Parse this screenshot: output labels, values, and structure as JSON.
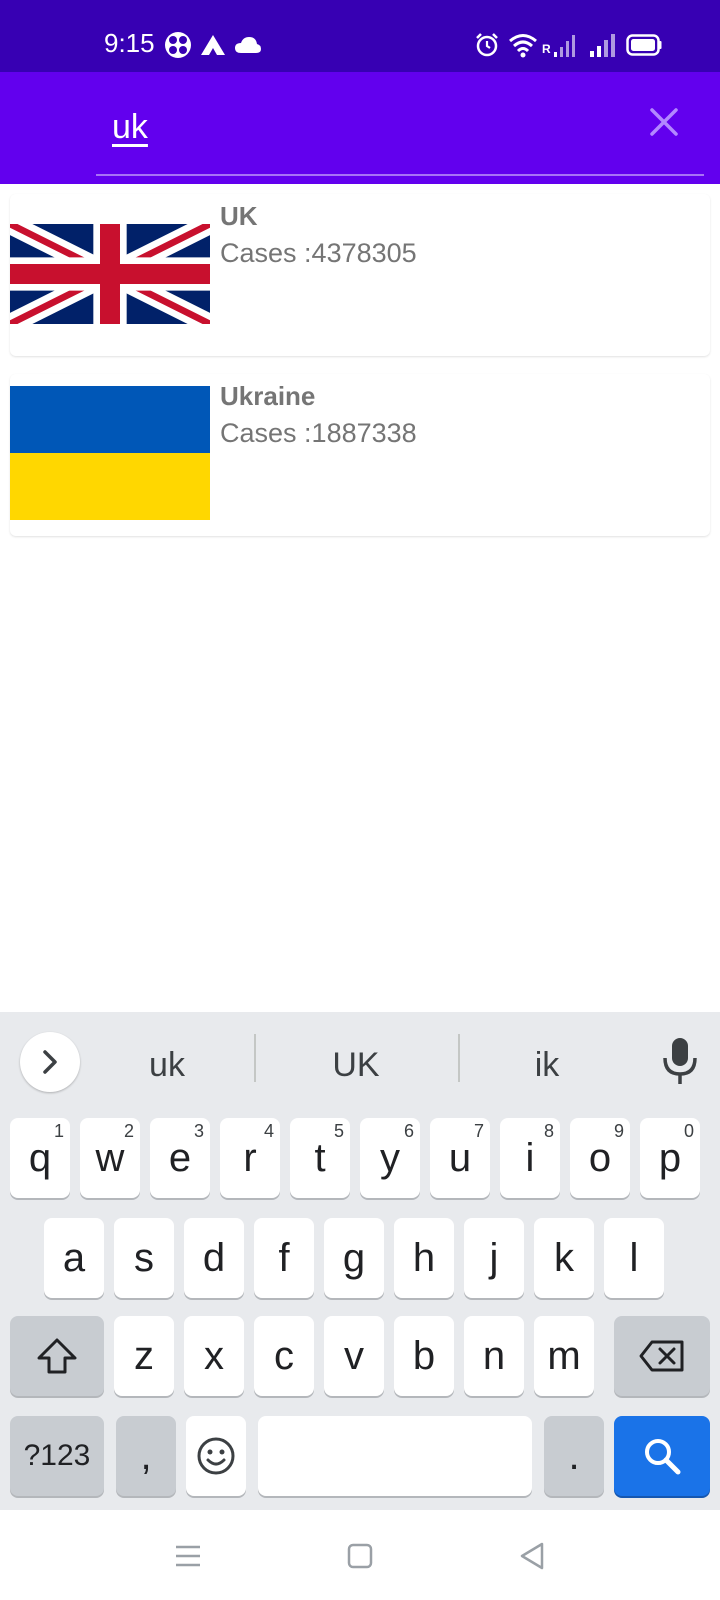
{
  "status_bar": {
    "time": "9:15",
    "left_icons": [
      "flower-app-icon",
      "ai-app-icon",
      "cloud-icon"
    ],
    "right_icons": [
      "alarm-icon",
      "wifi-icon",
      "signal-roaming-icon",
      "signal-icon",
      "battery-icon"
    ],
    "roaming_label": "R"
  },
  "search": {
    "query": "uk",
    "clear_icon": "close-icon"
  },
  "results": [
    {
      "country": "UK",
      "cases_label": "Cases :",
      "cases": "4378305",
      "flag": "uk-flag"
    },
    {
      "country": "Ukraine",
      "cases_label": "Cases :",
      "cases": "1887338",
      "flag": "ukraine-flag"
    }
  ],
  "keyboard": {
    "suggestions": [
      "uk",
      "UK",
      "ik"
    ],
    "row1": [
      {
        "k": "q",
        "n": "1"
      },
      {
        "k": "w",
        "n": "2"
      },
      {
        "k": "e",
        "n": "3"
      },
      {
        "k": "r",
        "n": "4"
      },
      {
        "k": "t",
        "n": "5"
      },
      {
        "k": "y",
        "n": "6"
      },
      {
        "k": "u",
        "n": "7"
      },
      {
        "k": "i",
        "n": "8"
      },
      {
        "k": "o",
        "n": "9"
      },
      {
        "k": "p",
        "n": "0"
      }
    ],
    "row2": [
      "a",
      "s",
      "d",
      "f",
      "g",
      "h",
      "j",
      "k",
      "l"
    ],
    "row3": [
      "z",
      "x",
      "c",
      "v",
      "b",
      "n",
      "m"
    ],
    "symbols_label": "?123",
    "comma_label": ",",
    "period_label": "."
  },
  "colors": {
    "status_bar": "#3700b3",
    "app_bar": "#6200ee",
    "search_key": "#1a73e8",
    "keyboard_bg": "#e8eaed",
    "card_text": "#757575"
  },
  "nav_bar": {
    "icons": [
      "menu-icon",
      "home-icon",
      "back-icon"
    ]
  }
}
